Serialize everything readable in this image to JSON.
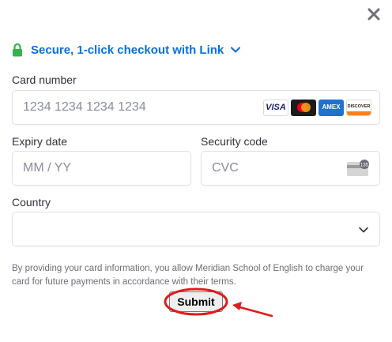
{
  "link": {
    "text": "Secure, 1-click checkout with Link",
    "icon": "lock-icon",
    "accent": "#0570de",
    "lock_color": "#33b44a"
  },
  "card": {
    "label": "Card number",
    "placeholder": "1234 1234 1234 1234",
    "brands": [
      "VISA",
      "Mastercard",
      "AMEX",
      "DISCOVER"
    ]
  },
  "expiry": {
    "label": "Expiry date",
    "placeholder": "MM / YY"
  },
  "cvc": {
    "label": "Security code",
    "placeholder": "CVC",
    "icon_text": "135"
  },
  "country": {
    "label": "Country",
    "value": ""
  },
  "disclaimer": "By providing your card information, you allow Meridian School of English to charge your card for future payments in accordance with their terms.",
  "submit_label": "Submit",
  "annotation_color": "#e01b1b"
}
